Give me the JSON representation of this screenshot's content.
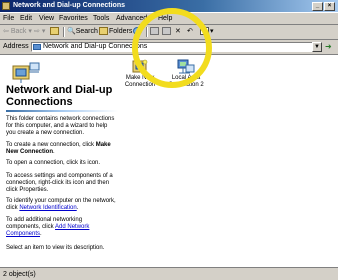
{
  "window": {
    "title": "Network and Dial-up Connections",
    "minimize_glyph": "_",
    "close_glyph": "×"
  },
  "menu": {
    "items": [
      "File",
      "Edit",
      "View",
      "Favorites",
      "Tools",
      "Advanced",
      "Help"
    ]
  },
  "toolbar": {
    "back_label": "Back",
    "search_label": "Search",
    "folders_label": "Folders"
  },
  "address": {
    "label": "Address",
    "value": "Network and Dial-up Connections"
  },
  "left_pane": {
    "heading": "Network and Dial-up Connections",
    "intro": "This folder contains network connections for this computer, and a wizard to help you create a new connection.",
    "create_prefix": "To create a new connection, click",
    "create_bold": "Make New Connection",
    "open_text": "To open a connection, click its icon.",
    "access_text": "To access settings and components of a connection, right-click its icon and then click Properties.",
    "identify_prefix": "To identify your computer on the network, click",
    "identify_link": "Network Identification",
    "add_prefix": "To add additional networking components, click",
    "add_link": "Add Network Components",
    "select_text": "Select an item to view its description."
  },
  "items": [
    {
      "label": "Make New Connection",
      "icon": "make-new-connection-icon"
    },
    {
      "label": "Local Area Connection 2",
      "icon": "local-area-connection-icon"
    }
  ],
  "status": {
    "text": "2 object(s)"
  },
  "colors": {
    "titlebar": "#0a246a",
    "chrome": "#d4d0c8",
    "highlight_ring": "#f2dc1e",
    "link": "#0000cc"
  }
}
